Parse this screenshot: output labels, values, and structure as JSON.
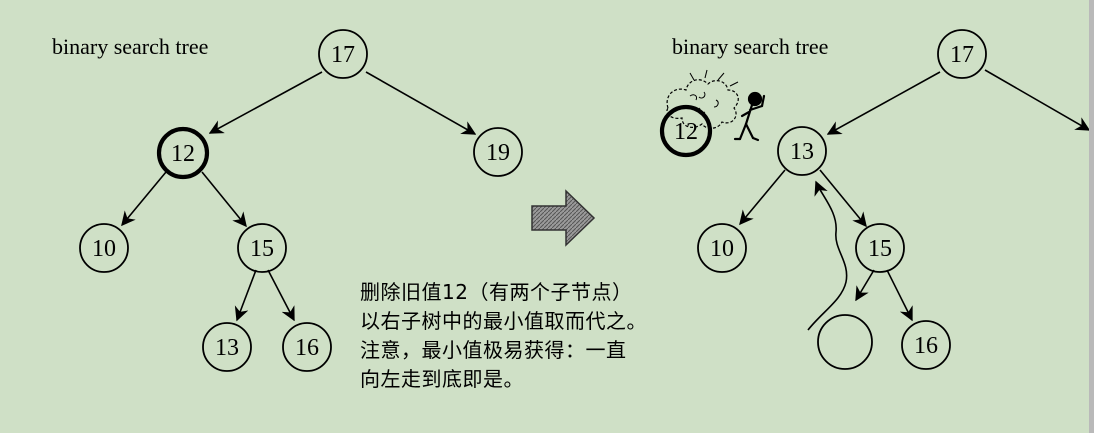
{
  "left_tree": {
    "title": "binary search tree",
    "root": "17",
    "left_child": "12",
    "right_child": "19",
    "n10": "10",
    "n15": "15",
    "n13": "13",
    "n16": "16"
  },
  "right_tree": {
    "title": "binary search tree",
    "root": "17",
    "removed_node": "12",
    "new_node": "13",
    "n10": "10",
    "n15": "15",
    "n16": "16"
  },
  "note": {
    "lines": [
      "删除旧值12（有两个子节点）",
      "以右子树中的最小值取而代之。",
      "注意，最小值极易获得：一直",
      "向左走到底即是。"
    ]
  },
  "colors": {
    "background": "#cfe0c6",
    "arrow": "#888888"
  },
  "icons": [
    "right-arrow-icon",
    "explosion-icon",
    "stick-figure-icon"
  ]
}
